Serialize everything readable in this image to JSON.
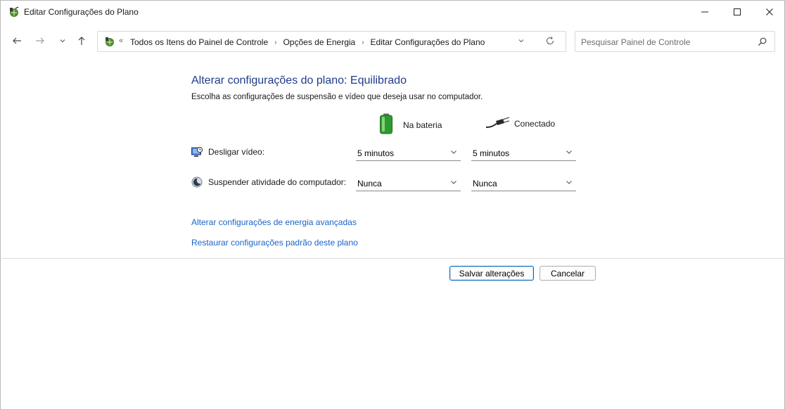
{
  "window": {
    "title": "Editar Configurações do Plano",
    "controls": {
      "minimize": "—",
      "maximize": "☐",
      "close": "✕"
    }
  },
  "nav": {
    "back": "←",
    "forward": "→",
    "recent": "⌄",
    "up": "↑",
    "address": {
      "overflow": "«",
      "breadcrumbs": [
        "Todos os Itens do Painel de Controle",
        "Opções de Energia",
        "Editar Configurações do Plano"
      ],
      "separator": "›"
    },
    "search": {
      "placeholder": "Pesquisar Painel de Controle"
    }
  },
  "content": {
    "heading": "Alterar configurações do plano: Equilibrado",
    "subheading": "Escolha as configurações de suspensão e vídeo que deseja usar no computador.",
    "columns": {
      "battery": "Na bateria",
      "plugged": "Conectado"
    },
    "rows": [
      {
        "label": "Desligar vídeo:",
        "battery": "5 minutos",
        "plugged": "5 minutos"
      },
      {
        "label": "Suspender atividade do computador:",
        "battery": "Nunca",
        "plugged": "Nunca"
      }
    ],
    "links": {
      "advanced": "Alterar configurações de energia avançadas",
      "restore": "Restaurar configurações padrão deste plano"
    }
  },
  "buttons": {
    "save": "Salvar alterações",
    "cancel": "Cancelar"
  },
  "colors": {
    "heading": "#1e3c8c",
    "link": "#1a64c8",
    "primary_border": "#0067c0"
  },
  "icons": [
    "power-options-icon",
    "battery-icon",
    "power-plug-icon",
    "display-icon",
    "sleep-moon-icon",
    "search-icon",
    "refresh-icon"
  ]
}
